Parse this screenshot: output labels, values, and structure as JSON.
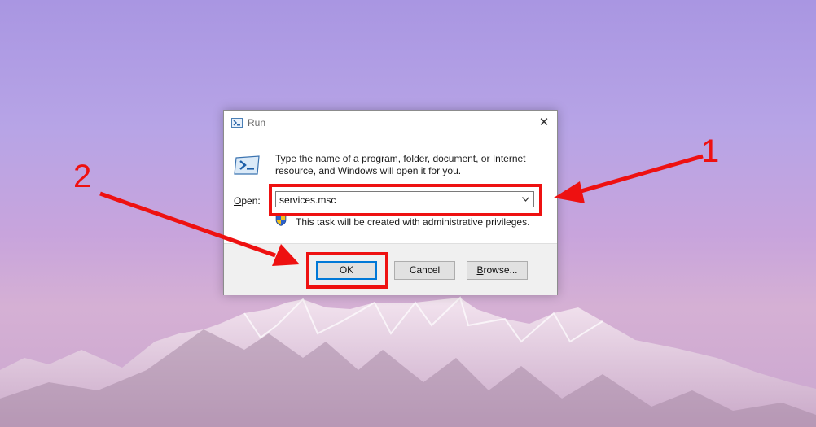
{
  "dialog": {
    "title": "Run",
    "description": "Type the name of a program, folder, document, or Internet resource, and Windows will open it for you.",
    "open_label_accel": "O",
    "open_label_rest": "pen:",
    "open_value": "services.msc",
    "admin_note": "This task will be created with administrative privileges.",
    "buttons": {
      "ok": "OK",
      "cancel": "Cancel",
      "browse_accel": "B",
      "browse_rest": "rowse..."
    }
  },
  "annotations": {
    "step1": "1",
    "step2": "2",
    "color": "#ee1111"
  },
  "colors": {
    "accent_focus": "#0078d7",
    "sky_top": "#a996e2",
    "sky_bottom": "#d5b0d4"
  }
}
